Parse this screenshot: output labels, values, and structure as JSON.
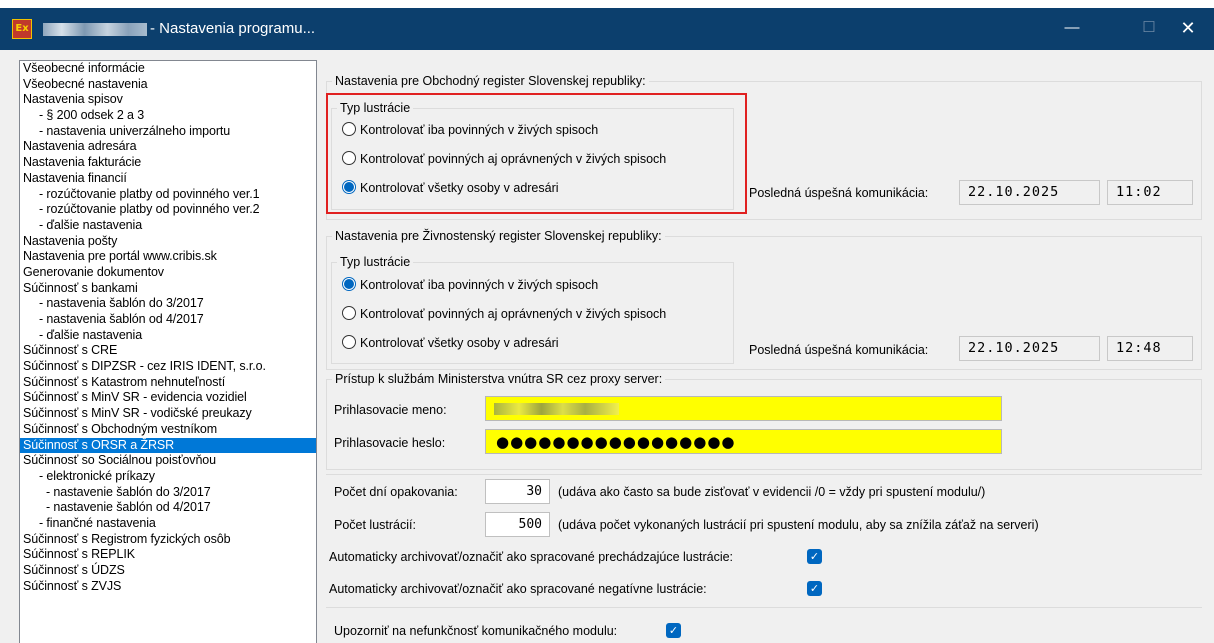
{
  "window": {
    "app_icon": "app-logo-icon",
    "app_icon_text": "Ex",
    "title": "- Nastavenia programu...",
    "minimize_symbol": "—",
    "maximize_symbol": "☐",
    "close_symbol": "✕"
  },
  "nav": {
    "items": [
      {
        "label": "Všeobecné informácie",
        "level": 0
      },
      {
        "label": "Všeobecné nastavenia",
        "level": 0
      },
      {
        "label": "Nastavenia spisov",
        "level": 0
      },
      {
        "label": "- § 200 odsek 2 a 3",
        "level": 1
      },
      {
        "label": "- nastavenia univerzálneho importu",
        "level": 1
      },
      {
        "label": "Nastavenia adresára",
        "level": 0
      },
      {
        "label": "Nastavenia fakturácie",
        "level": 0
      },
      {
        "label": "Nastavenia financií",
        "level": 0
      },
      {
        "label": "- rozúčtovanie platby od povinného ver.1",
        "level": 1
      },
      {
        "label": "- rozúčtovanie platby od povinného ver.2",
        "level": 1
      },
      {
        "label": "- ďalšie nastavenia",
        "level": 1
      },
      {
        "label": "Nastavenia pošty",
        "level": 0
      },
      {
        "label": "Nastavenia pre portál www.cribis.sk",
        "level": 0
      },
      {
        "label": "Generovanie dokumentov",
        "level": 0
      },
      {
        "label": "Súčinnosť s bankami",
        "level": 0
      },
      {
        "label": "- nastavenia šablón do 3/2017",
        "level": 1
      },
      {
        "label": "- nastavenia šablón od 4/2017",
        "level": 1
      },
      {
        "label": "- ďalšie nastavenia",
        "level": 1
      },
      {
        "label": "Súčinnosť s CRE",
        "level": 0
      },
      {
        "label": "Súčinnosť s DIPZSR - cez IRIS IDENT, s.r.o.",
        "level": 0
      },
      {
        "label": "Súčinnosť s Katastrom nehnuteľností",
        "level": 0
      },
      {
        "label": "Súčinnosť s MinV SR - evidencia vozidiel",
        "level": 0
      },
      {
        "label": "Súčinnosť s MinV SR - vodičské preukazy",
        "level": 0
      },
      {
        "label": "Súčinnosť s Obchodným vestníkom",
        "level": 0
      },
      {
        "label": "Súčinnosť s ORSR a ŽRSR",
        "level": 0,
        "selected": true
      },
      {
        "label": "Súčinnosť so Sociálnou poisťovňou",
        "level": 0
      },
      {
        "label": "- elektronické príkazy",
        "level": 1
      },
      {
        "label": "- nastavenie šablón do 3/2017",
        "level": 2
      },
      {
        "label": "- nastavenie šablón od 4/2017",
        "level": 2
      },
      {
        "label": "- finančné nastavenia",
        "level": 1
      },
      {
        "label": "Súčinnosť s Registrom fyzických osôb",
        "level": 0
      },
      {
        "label": "Súčinnosť s REPLIK",
        "level": 0
      },
      {
        "label": "Súčinnosť s ÚDZS",
        "level": 0
      },
      {
        "label": "Súčinnosť s ZVJS",
        "level": 0
      }
    ]
  },
  "orsr": {
    "group_title": "Nastavenia pre Obchodný register Slovenskej republiky:",
    "lustr_title": "Typ lustrácie",
    "options": [
      "Kontrolovať iba povinných v živých spisoch",
      "Kontrolovať povinných aj oprávnených v živých spisoch",
      "Kontrolovať všetky osoby v adresári"
    ],
    "selected_index": 2,
    "last_comm_label": "Posledná úspešná komunikácia:",
    "last_comm_date": "22.10.2025",
    "last_comm_time": "11:02"
  },
  "zrsr": {
    "group_title": "Nastavenia pre Živnostenský register Slovenskej republiky:",
    "lustr_title": "Typ lustrácie",
    "options": [
      "Kontrolovať iba povinných v živých spisoch",
      "Kontrolovať povinných aj oprávnených v živých spisoch",
      "Kontrolovať všetky osoby v adresári"
    ],
    "selected_index": 0,
    "last_comm_label": "Posledná úspešná komunikácia:",
    "last_comm_date": "22.10.2025",
    "last_comm_time": "12:48"
  },
  "proxy": {
    "group_title": "Prístup k službám Ministerstva vnútra SR cez proxy server:",
    "user_label": "Prihlasovacie meno:",
    "pass_label": "Prihlasovacie heslo:",
    "pass_mask": "●●●●●●●●●●●●●●●●●"
  },
  "params": {
    "days_label": "Počet dní opakovania:",
    "days_value": "30",
    "days_hint": "(udáva ako často sa bude zisťovať v evidencii  /0 = vždy pri spustení modulu/)",
    "count_label": "Počet lustrácií:",
    "count_value": "500",
    "count_hint": "(udáva počet vykonaných lustrácií pri spustení modulu, aby sa znížila záťaž na serveri)",
    "archive_prev_label": "Automaticky archivovať/označiť ako spracované prechádzajúce lustrácie:",
    "archive_prev_checked": true,
    "archive_neg_label": "Automaticky archivovať/označiť ako spracované negatívne lustrácie:",
    "archive_neg_checked": true,
    "notify_label": "Upozorniť na nefunkčnosť komunikačného modulu:",
    "notify_checked": true
  },
  "colors": {
    "titlebar": "#0c3f6d",
    "selection": "#0078d7",
    "highlight": "#e02020",
    "field_yellow": "#ffff00",
    "accent": "#0067c0"
  }
}
